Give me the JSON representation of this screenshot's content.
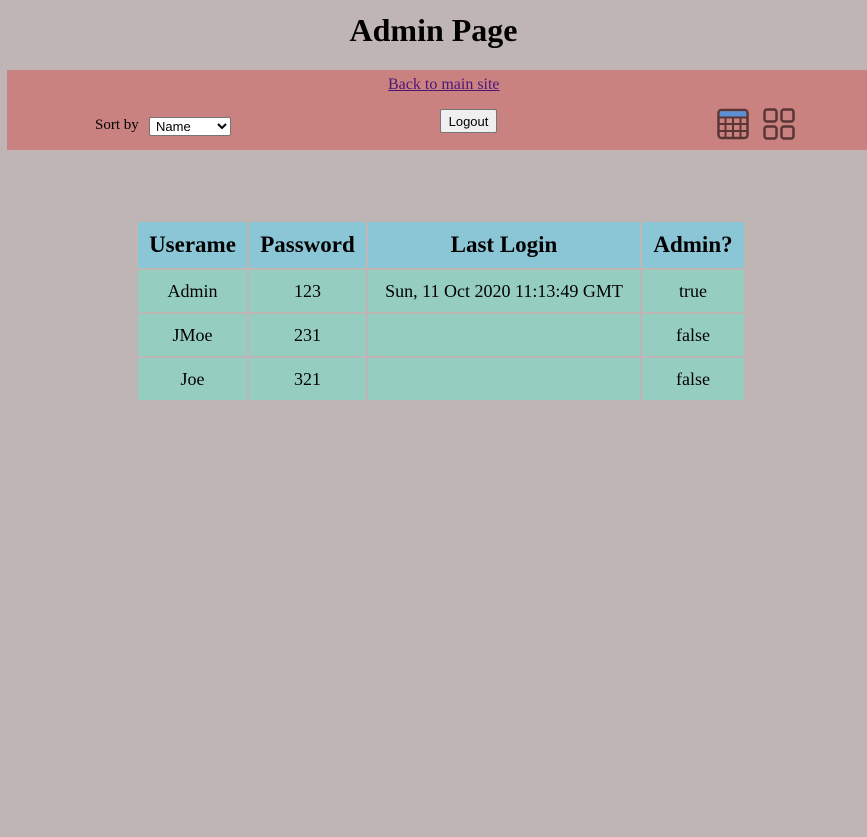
{
  "page": {
    "title": "Admin Page"
  },
  "nav": {
    "back_link": "Back to main site",
    "sort_label": "Sort by",
    "sort_selected": "Name",
    "logout_label": "Logout",
    "icons": [
      "table-view-icon",
      "grid-view-icon"
    ]
  },
  "table": {
    "headers": {
      "username": "Userame",
      "password": "Password",
      "last_login": "Last Login",
      "admin": "Admin?"
    },
    "rows": [
      {
        "username": "Admin",
        "password": "123",
        "last_login": "Sun, 11 Oct 2020 11:13:49 GMT",
        "admin": "true"
      },
      {
        "username": "JMoe",
        "password": "231",
        "last_login": "",
        "admin": "false"
      },
      {
        "username": "Joe",
        "password": "321",
        "last_login": "",
        "admin": "false"
      }
    ]
  },
  "colors": {
    "background": "#bfb5b4",
    "nav_bar": "#c98280",
    "header_cell": "#8ac6d6",
    "body_cell": "#96cdc1",
    "icon_stroke": "#5a3535",
    "icon_accent": "#5b8fd6"
  }
}
